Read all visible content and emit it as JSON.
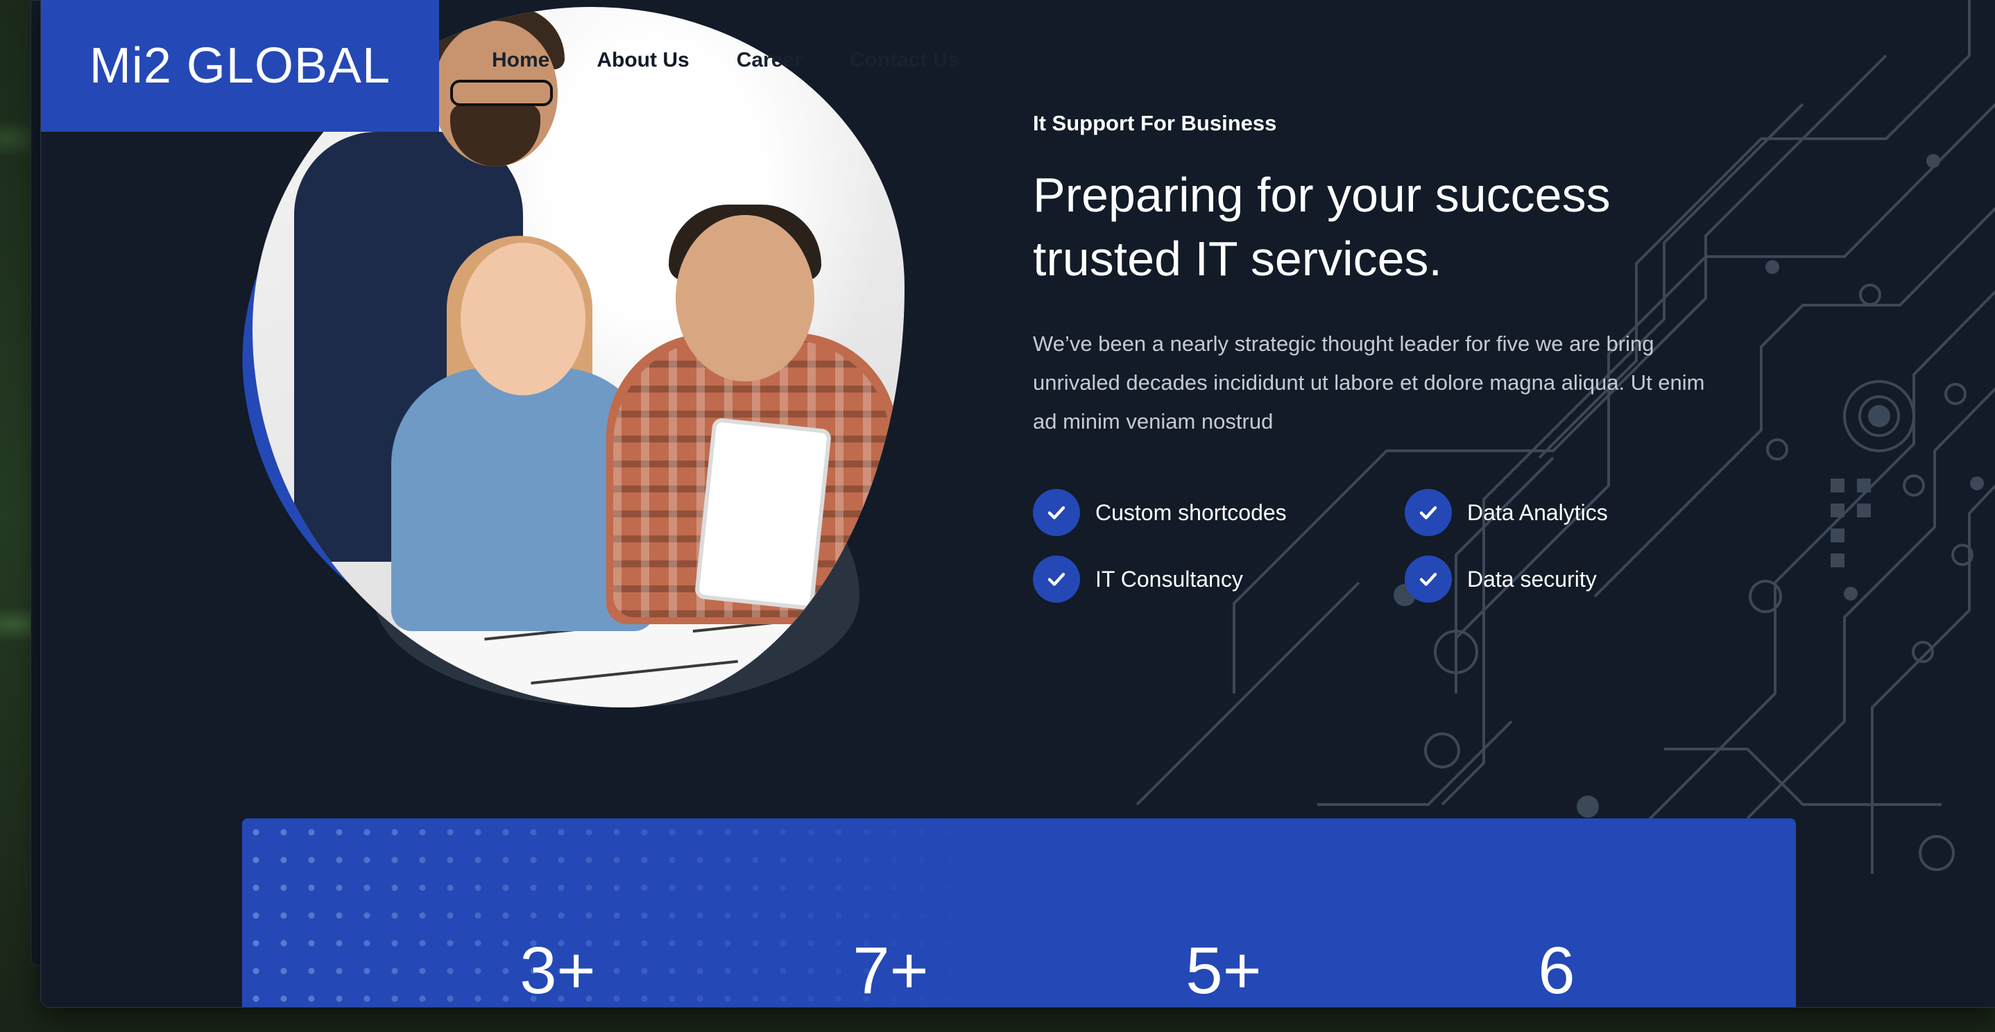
{
  "brand": {
    "logo": "Mi2 GLOBAL",
    "accent_color": "#2448b5",
    "background_color": "#121b27"
  },
  "nav": {
    "items": [
      {
        "label": "Home",
        "active": false
      },
      {
        "label": "About Us",
        "active": true
      },
      {
        "label": "Career",
        "active": false
      },
      {
        "label": "Contact Us",
        "active": false
      }
    ]
  },
  "hero": {
    "eyebrow": "It Support For Business",
    "headline_line1": "Preparing for your success",
    "headline_line2": "trusted IT services.",
    "description": "We’ve been a nearly strategic thought leader for five we are bring unrivaled decades incididunt ut labore et dolore magna aliqua. Ut enim ad minim veniam nostrud",
    "features": [
      {
        "label": "Custom shortcodes",
        "icon": "check-icon"
      },
      {
        "label": "Data Analytics",
        "icon": "check-icon"
      },
      {
        "label": "IT Consultancy",
        "icon": "check-icon"
      },
      {
        "label": "Data security",
        "icon": "check-icon"
      }
    ]
  },
  "stats": {
    "values": [
      "3+",
      "7+",
      "5+",
      "6"
    ]
  }
}
